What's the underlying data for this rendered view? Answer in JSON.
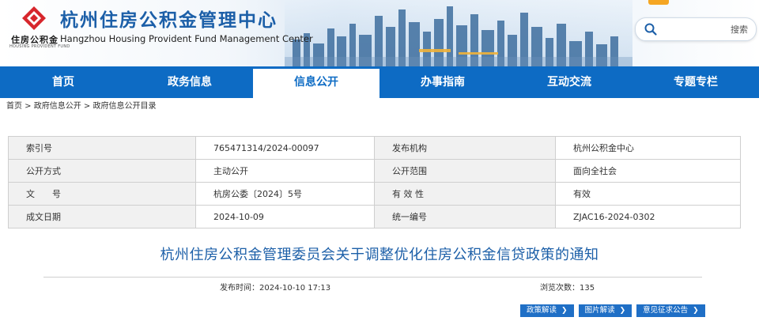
{
  "header": {
    "logo_cn": "住房公积金",
    "logo_en": "HOUSING PROVIDENT FUND",
    "title": "杭州住房公积金管理中心",
    "subtitle": "Hangzhou Housing Provident Fund Management Center",
    "search": {
      "placeholder": "",
      "button_label": "搜索",
      "icon": "search-icon"
    }
  },
  "nav": {
    "items": [
      {
        "label": "首页"
      },
      {
        "label": "政务信息"
      },
      {
        "label": "信息公开",
        "active": true
      },
      {
        "label": "办事指南"
      },
      {
        "label": "互动交流"
      },
      {
        "label": "专题专栏"
      }
    ]
  },
  "breadcrumb": {
    "items": [
      "首页",
      "政府信息公开",
      "政府信息公开目录"
    ],
    "separator": " > "
  },
  "info": {
    "rows": [
      {
        "k1": "索引号",
        "v1": "765471314/2024-00097",
        "k2": "发布机构",
        "v2": "杭州公积金中心"
      },
      {
        "k1": "公开方式",
        "v1": "主动公开",
        "k2": "公开范围",
        "v2": "面向全社会"
      },
      {
        "k1": "文　　号",
        "v1": "杭房公委〔2024〕5号",
        "k2": "有 效 性",
        "v2": "有效"
      },
      {
        "k1": "成文日期",
        "v1": "2024-10-09",
        "k2": "统一编号",
        "v2": "ZJAC16-2024-0302"
      }
    ]
  },
  "document": {
    "title": "杭州住房公积金管理委员会关于调整优化住房公积金信贷政策的通知",
    "publish_time": "发布时间：2024-10-10 17:13",
    "views": "浏览次数：135"
  },
  "actions": {
    "policy_interpretation": "政策解读",
    "graphic_interpretation": "图片解读",
    "public_comment": "意见征求公告"
  },
  "colors": {
    "brand_blue": "#0d6bc4",
    "title_blue": "#1c5fa8",
    "logo_red": "#d7262c"
  }
}
